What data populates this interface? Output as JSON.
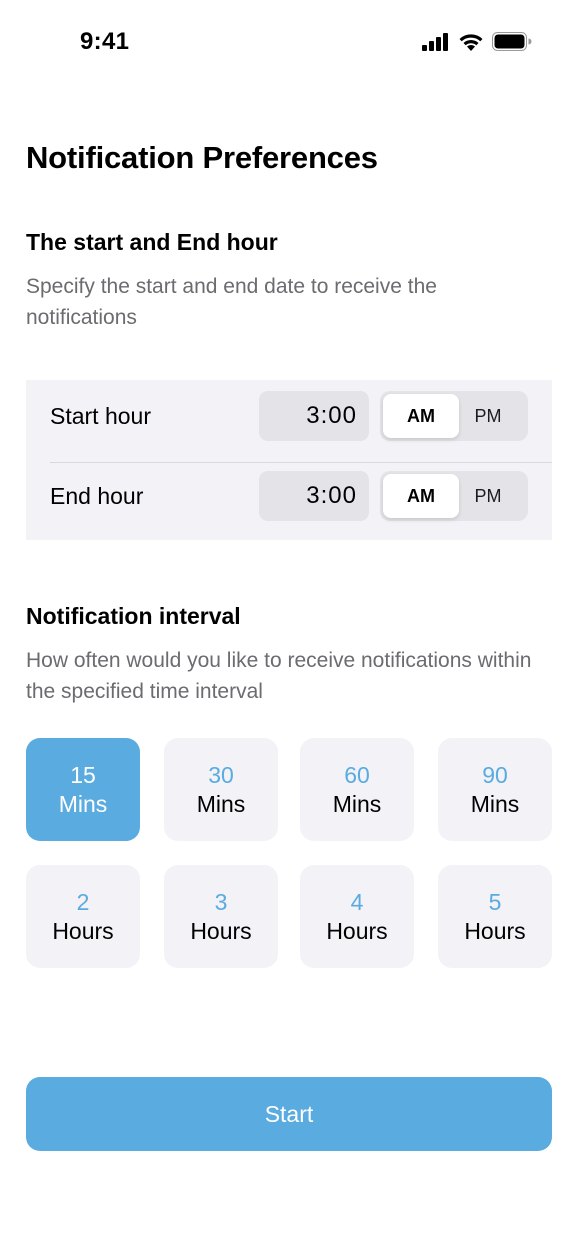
{
  "status_bar": {
    "time": "9:41"
  },
  "page": {
    "title": "Notification Preferences"
  },
  "hours_section": {
    "title": "The start and End hour",
    "description": "Specify the start and end date to receive the notifications",
    "rows": [
      {
        "label": "Start hour",
        "time": "3:00",
        "am_label": "AM",
        "pm_label": "PM",
        "selected": "AM"
      },
      {
        "label": "End hour",
        "time": "3:00",
        "am_label": "AM",
        "pm_label": "PM",
        "selected": "AM"
      }
    ]
  },
  "interval_section": {
    "title": "Notification interval",
    "description": "How often would you like to receive notifications within the specified time interval",
    "options": [
      {
        "value": "15",
        "unit": "Mins",
        "selected": true
      },
      {
        "value": "30",
        "unit": "Mins",
        "selected": false
      },
      {
        "value": "60",
        "unit": "Mins",
        "selected": false
      },
      {
        "value": "90",
        "unit": "Mins",
        "selected": false
      },
      {
        "value": "2",
        "unit": "Hours",
        "selected": false
      },
      {
        "value": "3",
        "unit": "Hours",
        "selected": false
      },
      {
        "value": "4",
        "unit": "Hours",
        "selected": false
      },
      {
        "value": "5",
        "unit": "Hours",
        "selected": false
      }
    ]
  },
  "start_button": {
    "label": "Start"
  },
  "colors": {
    "accent": "#5aabe0",
    "panel": "#f2f2f7",
    "muted_text": "#6b6b70"
  }
}
